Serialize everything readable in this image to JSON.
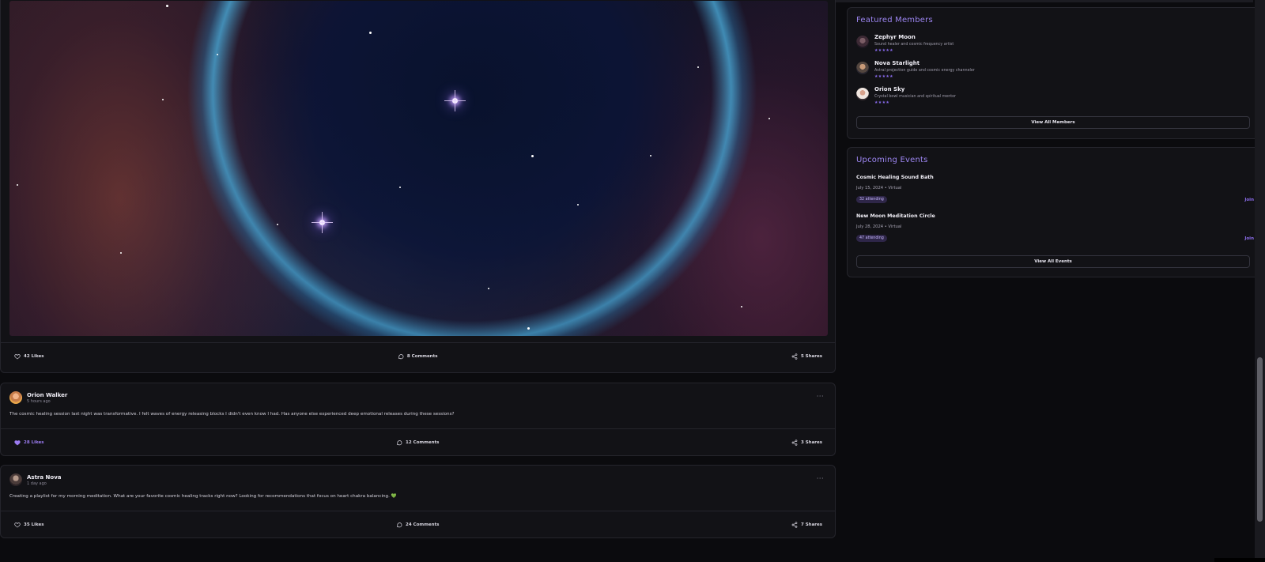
{
  "feed": {
    "image_post": {
      "image_alt": "nebula bubble",
      "likes": "42 Likes",
      "comments": "8 Comments",
      "shares": "5 Shares"
    },
    "posts": [
      {
        "author": "Orion Walker",
        "time": "5 hours ago",
        "text": "The cosmic healing session last night was transformative. I felt waves of energy releasing blocks I didn't even know I had. Has anyone else experienced deep emotional releases during these sessions?",
        "emoji": "",
        "likes": "28 Likes",
        "liked": true,
        "comments": "12 Comments",
        "shares": "3 Shares"
      },
      {
        "author": "Astra Nova",
        "time": "1 day ago",
        "text": "Creating a playlist for my morning meditation. What are your favorite cosmic healing tracks right now? Looking for recommendations that focus on heart chakra balancing.",
        "emoji": "💚",
        "likes": "35 Likes",
        "liked": false,
        "comments": "24 Comments",
        "shares": "7 Shares"
      }
    ],
    "more_label": "···"
  },
  "sidebar": {
    "featured": {
      "title": "Featured Members",
      "members": [
        {
          "name": "Zephyr Moon",
          "desc": "Sound healer and cosmic frequency artist",
          "stars": "★★★★★"
        },
        {
          "name": "Nova Starlight",
          "desc": "Astral projection guide and cosmic energy channeler",
          "stars": "★★★★★"
        },
        {
          "name": "Orion Sky",
          "desc": "Crystal bowl musician and spiritual mentor",
          "stars": "★★★★"
        }
      ],
      "button": "View All Members"
    },
    "events": {
      "title": "Upcoming Events",
      "items": [
        {
          "title": "Cosmic Healing Sound Bath",
          "meta": "July 15, 2024 • Virtual",
          "attending": "32 attending",
          "join": "Join"
        },
        {
          "title": "New Moon Meditation Circle",
          "meta": "July 28, 2024 • Virtual",
          "attending": "47 attending",
          "join": "Join"
        }
      ],
      "button": "View All Events"
    }
  },
  "colors": {
    "accent": "#9d86f2",
    "background": "#0b0b0e",
    "card": "#121216",
    "border": "#25252c",
    "liked": "#9b7bf0",
    "emoji_heart": "#29d26a"
  },
  "icons": {
    "like": "heart-icon",
    "comment": "comment-icon",
    "share": "share-icon",
    "more": "more-icon"
  }
}
